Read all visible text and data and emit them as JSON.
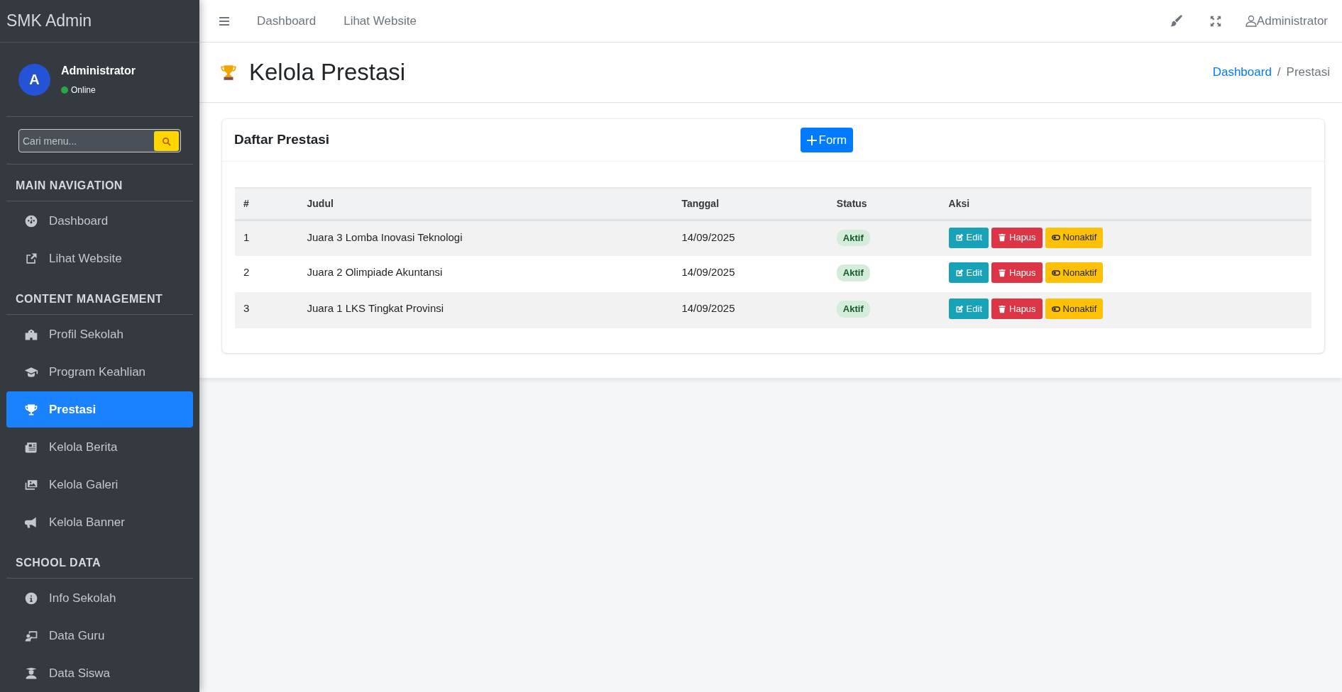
{
  "sidebar": {
    "brand": "SMK Admin",
    "user": {
      "initial": "A",
      "name": "Administrator",
      "status": "Online"
    },
    "search": {
      "placeholder": "Cari menu..."
    },
    "sections": [
      {
        "title": "MAIN NAVIGATION",
        "items": [
          {
            "label": "Dashboard",
            "selected": false
          },
          {
            "label": "Lihat Website",
            "selected": false
          }
        ]
      },
      {
        "title": "CONTENT MANAGEMENT",
        "items": [
          {
            "label": "Profil Sekolah",
            "selected": false
          },
          {
            "label": "Program Keahlian",
            "selected": false
          },
          {
            "label": "Prestasi",
            "selected": true
          },
          {
            "label": "Kelola Berita",
            "selected": false
          },
          {
            "label": "Kelola Galeri",
            "selected": false
          },
          {
            "label": "Kelola Banner",
            "selected": false
          }
        ]
      },
      {
        "title": "SCHOOL DATA",
        "items": [
          {
            "label": "Info Sekolah",
            "selected": false
          },
          {
            "label": "Data Guru",
            "selected": false
          },
          {
            "label": "Data Siswa",
            "selected": false
          }
        ]
      }
    ]
  },
  "topbar": {
    "links": [
      "Dashboard",
      "Lihat Website"
    ],
    "user": "Administrator"
  },
  "page": {
    "title": "Kelola Prestasi",
    "breadcrumb": [
      {
        "label": "Dashboard",
        "kind": "link"
      },
      {
        "label": "/",
        "kind": "separator"
      },
      {
        "label": "Prestasi",
        "kind": "current"
      }
    ]
  },
  "card": {
    "title": "Daftar Prestasi",
    "add_button": "Form",
    "table": {
      "columns": [
        "#",
        "Judul",
        "Tanggal",
        "Status",
        "Aksi"
      ],
      "rows": [
        {
          "no": "1",
          "title": "Juara 3 Lomba Inovasi Teknologi",
          "date": "14/09/2025",
          "status": "Aktif",
          "actions": [
            {
              "kind": "edit",
              "label": "Edit"
            },
            {
              "kind": "delete",
              "label": "Hapus"
            },
            {
              "kind": "toggle",
              "label": "Nonaktif"
            }
          ]
        },
        {
          "no": "2",
          "title": "Juara 2 Olimpiade Akuntansi",
          "date": "14/09/2025",
          "status": "Aktif",
          "actions": [
            {
              "kind": "edit",
              "label": "Edit"
            },
            {
              "kind": "delete",
              "label": "Hapus"
            },
            {
              "kind": "toggle",
              "label": "Nonaktif"
            }
          ]
        },
        {
          "no": "3",
          "title": "Juara 1 LKS Tingkat Provinsi",
          "date": "14/09/2025",
          "status": "Aktif",
          "actions": [
            {
              "kind": "edit",
              "label": "Edit"
            },
            {
              "kind": "delete",
              "label": "Hapus"
            },
            {
              "kind": "toggle",
              "label": "Nonaktif"
            }
          ]
        }
      ]
    }
  }
}
